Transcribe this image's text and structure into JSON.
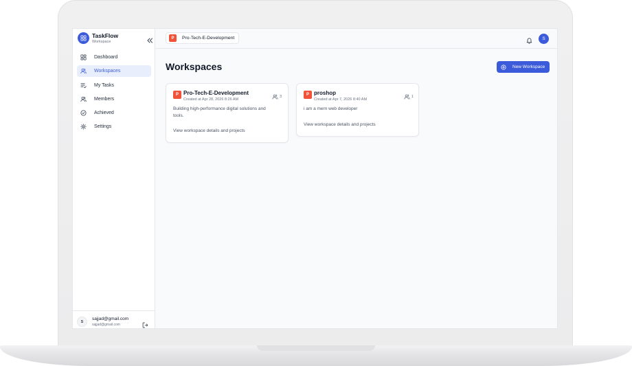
{
  "colors": {
    "accent": "#3b5bdb",
    "accent_soft": "#e8eefc",
    "workspace_badge": "#f0533a",
    "text_primary": "#111827",
    "text_muted": "#6b7280"
  },
  "app": {
    "name": "TaskFlow",
    "subtitle": "Workspace",
    "logo_icon": "grid-icon",
    "collapse_icon": "chevrons-left-icon"
  },
  "sidebar": {
    "items": [
      {
        "label": "Dashboard",
        "icon": "dashboard-icon",
        "active": false
      },
      {
        "label": "Workspaces",
        "icon": "users-icon",
        "active": true
      },
      {
        "label": "My Tasks",
        "icon": "list-check-icon",
        "active": false
      },
      {
        "label": "Members",
        "icon": "members-icon",
        "active": false
      },
      {
        "label": "Achieved",
        "icon": "check-circle-icon",
        "active": false
      },
      {
        "label": "Settings",
        "icon": "gear-icon",
        "active": false
      }
    ],
    "user": {
      "initial": "S",
      "email": "sajjad@gmail.com",
      "email_sub": "sajjad@gmail.com",
      "logout_icon": "logout-icon"
    }
  },
  "header": {
    "workspace_badge": "P",
    "workspace_name": "Pro-Tech-E-Development",
    "bell_icon": "bell-icon",
    "avatar_initial": "S"
  },
  "main": {
    "title": "Workspaces",
    "new_button_label": "New Workspace",
    "new_button_icon": "plus-circle-icon",
    "workspaces": [
      {
        "badge": "P",
        "name": "Pro-Tech-E-Development",
        "created": "Created at Apr 28, 2026 8:26 AM",
        "members": "3",
        "description_lines": [
          "Building high-performance digital solutions and",
          "tools."
        ],
        "link": "View workspace details and projects"
      },
      {
        "badge": "P",
        "name": "proshop",
        "created": "Created at Apr 7, 2026 8:40 AM",
        "members": "1",
        "description_lines": [
          "i am a mern web developer"
        ],
        "link": "View workspace details and projects"
      }
    ]
  }
}
